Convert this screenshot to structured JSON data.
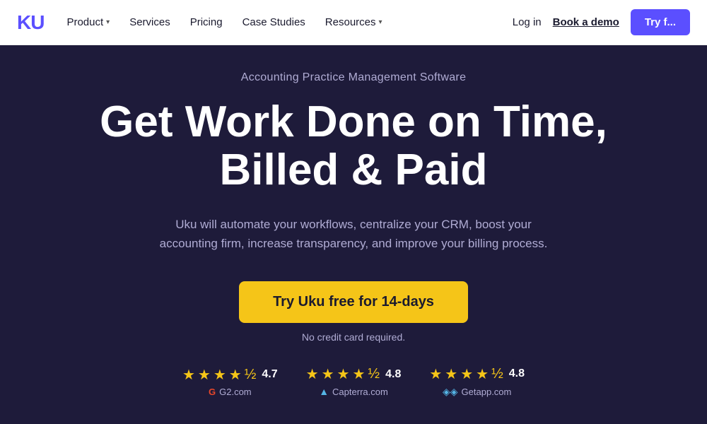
{
  "brand": {
    "logo": "KU",
    "logo_full": "Uku"
  },
  "navbar": {
    "items": [
      {
        "label": "Product",
        "has_dropdown": true
      },
      {
        "label": "Services",
        "has_dropdown": false
      },
      {
        "label": "Pricing",
        "has_dropdown": false
      },
      {
        "label": "Case Studies",
        "has_dropdown": false
      },
      {
        "label": "Resources",
        "has_dropdown": true
      }
    ],
    "login_label": "Log in",
    "demo_label": "Book a demo",
    "try_label": "Try f..."
  },
  "hero": {
    "subtitle": "Accounting Practice Management Software",
    "title_line1": "Get Work Done on Time,",
    "title_line2": "Billed & Paid",
    "description": "Uku will automate your workflows, centralize your CRM, boost your accounting firm, increase transparency, and improve your billing process.",
    "cta_label": "Try Uku free for 14-days",
    "no_cc_label": "No credit card required.",
    "ratings": [
      {
        "score": "4.7",
        "source": "G2.com",
        "icon": "G",
        "stars": 4.5
      },
      {
        "score": "4.8",
        "source": "Capterra.com",
        "icon": "▲",
        "stars": 4.5
      },
      {
        "score": "4.8",
        "source": "Getapp.com",
        "icon": "◈",
        "stars": 4.5
      }
    ]
  },
  "colors": {
    "brand_purple": "#5b4fff",
    "hero_bg": "#1e1b3a",
    "cta_yellow": "#f5c518",
    "text_muted": "#b0acd4",
    "text_white": "#ffffff"
  }
}
